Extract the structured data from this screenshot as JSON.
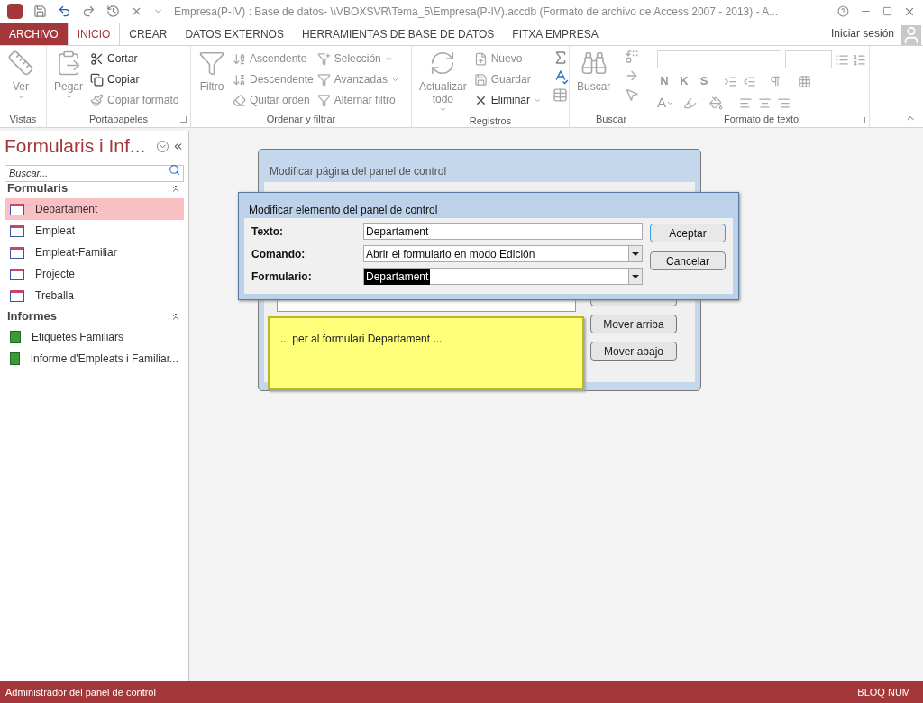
{
  "title_bar": {
    "title": "Empresa(P-IV) : Base de datos- \\\\VBOXSVR\\Tema_5\\Empresa(P-IV).accdb (Formato de archivo de Access 2007 - 2013) - A..."
  },
  "tabs": [
    {
      "label": "ARCHIVO",
      "kind": "file",
      "selected": false
    },
    {
      "label": "INICIO",
      "kind": "tab",
      "selected": true
    },
    {
      "label": "CREAR",
      "kind": "tab",
      "selected": false
    },
    {
      "label": "DATOS EXTERNOS",
      "kind": "tab",
      "selected": false
    },
    {
      "label": "HERRAMIENTAS DE BASE DE DATOS",
      "kind": "tab",
      "selected": false
    },
    {
      "label": "FITXA EMPRESA",
      "kind": "tab",
      "selected": false
    }
  ],
  "sign_in": "Iniciar sesión",
  "ribbon": [
    {
      "label": "Vistas",
      "dialog_launcher": false,
      "commands": [
        {
          "label": "Ver",
          "kind": "large",
          "disabled": true,
          "dropdown": true
        }
      ]
    },
    {
      "label": "Portapapeles",
      "dialog_launcher": true,
      "commands": [
        {
          "label": "Pegar",
          "kind": "large",
          "disabled": true,
          "dropdown": true
        },
        {
          "label": "Cortar",
          "kind": "small",
          "disabled": false,
          "dropdown": false
        },
        {
          "label": "Copiar",
          "kind": "small",
          "disabled": false,
          "dropdown": false
        },
        {
          "label": "Copiar formato",
          "kind": "small",
          "disabled": true,
          "dropdown": false
        }
      ]
    },
    {
      "label": "Ordenar y filtrar",
      "dialog_launcher": false,
      "commands": [
        {
          "label": "Filtro",
          "kind": "large",
          "disabled": true,
          "dropdown": false
        },
        {
          "label": "Ascendente",
          "kind": "small",
          "disabled": true,
          "dropdown": false
        },
        {
          "label": "Descendente",
          "kind": "small",
          "disabled": true,
          "dropdown": false
        },
        {
          "label": "Quitar orden",
          "kind": "small",
          "disabled": true,
          "dropdown": false
        },
        {
          "label": "Selección",
          "kind": "small",
          "disabled": true,
          "dropdown": true
        },
        {
          "label": "Avanzadas",
          "kind": "small",
          "disabled": true,
          "dropdown": true
        },
        {
          "label": "Alternar filtro",
          "kind": "small",
          "disabled": true,
          "dropdown": false
        }
      ]
    },
    {
      "label": "Registros",
      "dialog_launcher": false,
      "commands": [
        {
          "label": "Actualizar todo",
          "kind": "large",
          "disabled": true,
          "dropdown": true
        },
        {
          "label": "Nuevo",
          "kind": "small",
          "disabled": true,
          "dropdown": false
        },
        {
          "label": "Guardar",
          "kind": "small",
          "disabled": true,
          "dropdown": false
        },
        {
          "label": "Eliminar",
          "kind": "small",
          "disabled": false,
          "dropdown": true
        }
      ]
    },
    {
      "label": "Buscar",
      "dialog_launcher": false,
      "commands": [
        {
          "label": "Buscar",
          "kind": "large",
          "disabled": true,
          "dropdown": false
        }
      ]
    },
    {
      "label": "Formato de texto",
      "dialog_launcher": true,
      "commands": [
        {
          "label": "N",
          "kind": "format",
          "disabled": true,
          "dropdown": false
        },
        {
          "label": "K",
          "kind": "format",
          "disabled": true,
          "dropdown": false
        },
        {
          "label": "S",
          "kind": "format",
          "disabled": true,
          "dropdown": false
        },
        {
          "label": "A",
          "kind": "format",
          "disabled": true,
          "dropdown": true
        }
      ]
    }
  ],
  "nav": {
    "title": "Formularis i Inf...",
    "search_placeholder": "Buscar...",
    "sections": [
      {
        "label": "Formularis",
        "expanded": true,
        "items": [
          {
            "label": "Departament",
            "kind": "form",
            "selected": true
          },
          {
            "label": "Empleat",
            "kind": "form",
            "selected": false
          },
          {
            "label": "Empleat-Familiar",
            "kind": "form",
            "selected": false
          },
          {
            "label": "Projecte",
            "kind": "form",
            "selected": false
          },
          {
            "label": "Treballa",
            "kind": "form",
            "selected": false
          }
        ]
      },
      {
        "label": "Informes",
        "expanded": true,
        "items": [
          {
            "label": "Etiquetes Familiars",
            "kind": "report",
            "selected": false
          },
          {
            "label": "Informe d'Empleats i Familiar...",
            "kind": "report",
            "selected": false
          }
        ]
      }
    ]
  },
  "back_dialog": {
    "title": "Modificar página del panel de control",
    "buttons": [
      "Mover arriba",
      "Mover abajo"
    ]
  },
  "dialog": {
    "title": "Modificar elemento del panel de control",
    "fields": [
      {
        "label": "Texto:",
        "kind": "text",
        "value": "Departament",
        "highlighted": false
      },
      {
        "label": "Comando:",
        "kind": "select",
        "value": "Abrir el formulario en modo Edición",
        "highlighted": false
      },
      {
        "label": "Formulario:",
        "kind": "select",
        "value": "Departament",
        "highlighted": true
      }
    ],
    "buttons": [
      {
        "label": "Aceptar",
        "default": true
      },
      {
        "label": "Cancelar",
        "default": false
      }
    ]
  },
  "note": "... per al formulari Departament ...",
  "status_bar": {
    "left": "Administrador del panel de control",
    "right": "BLOQ NUM"
  }
}
